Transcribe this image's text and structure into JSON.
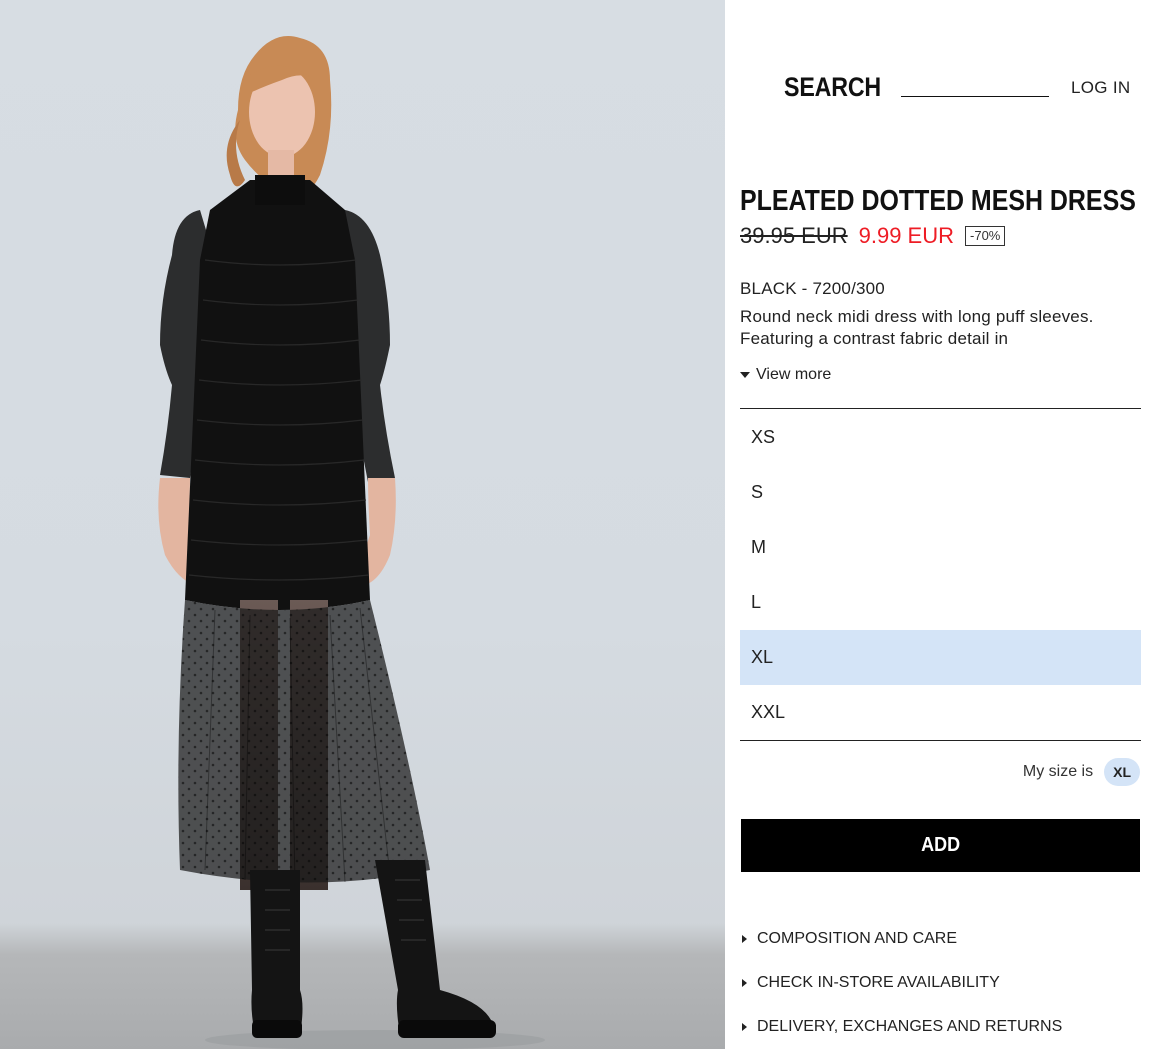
{
  "header": {
    "search_label": "SEARCH",
    "login_label": "LOG IN"
  },
  "product": {
    "name": "PLEATED DOTTED MESH DRESS",
    "old_price": "39.95 EUR",
    "new_price": "9.99 EUR",
    "discount": "-70%",
    "color_ref": "BLACK - 7200/300",
    "description": "Round neck midi dress with long puff sleeves. Featuring a contrast fabric detail in",
    "view_more": "View more",
    "image_alt": "Model wearing black dotted mesh midi dress with combat boots"
  },
  "sizes": {
    "options": [
      "XS",
      "S",
      "M",
      "L",
      "XL",
      "XXL"
    ],
    "selected": "XL"
  },
  "my_size": {
    "label": "My size is",
    "value": "XL"
  },
  "actions": {
    "add_label": "ADD"
  },
  "info_links": [
    "COMPOSITION AND CARE",
    "CHECK IN-STORE AVAILABILITY",
    "DELIVERY, EXCHANGES AND RETURNS"
  ],
  "colors": {
    "sale_red": "#ee1c25",
    "selected_blue": "#d4e4f7",
    "button_black": "#000000",
    "photo_background": "#d7dde3"
  }
}
